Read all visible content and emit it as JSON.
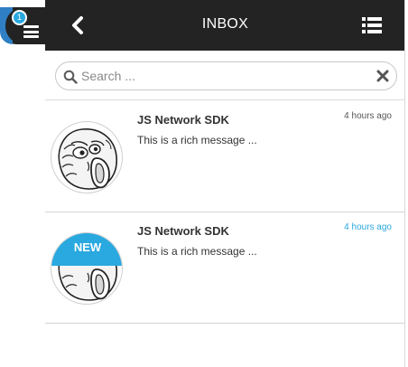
{
  "menu": {
    "badge_count": "1"
  },
  "header": {
    "title": "INBOX"
  },
  "search": {
    "placeholder": "Search ..."
  },
  "messages": [
    {
      "title": "JS Network SDK",
      "text": "This is a rich message ...",
      "time": "4 hours ago",
      "is_new": false
    },
    {
      "title": "JS Network SDK",
      "text": "This is a rich message ...",
      "time": "4 hours ago",
      "is_new": true,
      "new_label": "NEW"
    }
  ],
  "colors": {
    "header_bg": "#232323",
    "accent": "#2aa8e0",
    "side_accent": "#2f7fc4"
  },
  "icons": {
    "menu": "hamburger-icon",
    "back": "chevron-left-icon",
    "list": "list-icon",
    "search": "search-icon",
    "clear": "close-icon"
  }
}
